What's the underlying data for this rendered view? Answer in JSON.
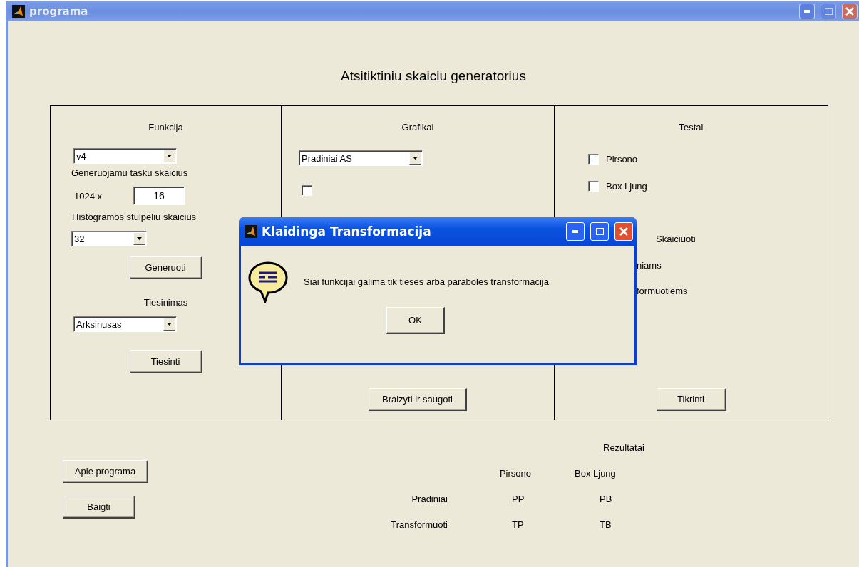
{
  "window": {
    "title": "programa"
  },
  "heading": "Atsitiktiniu skaiciu generatorius",
  "funkcija": {
    "title": "Funkcija",
    "function": "v4",
    "points_label": "Generuojamu tasku skaicius",
    "multiplier": "1024 x",
    "points_value": "16",
    "bins_label": "Histogramos stulpeliu skaicius",
    "bins": "32",
    "generate_button": "Generuoti",
    "transform_title": "Tiesinimas",
    "transform": "Arksinusas",
    "transform_button": "Tiesinti"
  },
  "grafikai": {
    "title": "Grafikai",
    "plot": "Pradiniai AS",
    "checkbox": {
      "checked": false
    },
    "button": "Braizyti ir saugoti"
  },
  "testai": {
    "title": "Testai",
    "tests": [
      {
        "label": "Pirsono",
        "checked": false
      },
      {
        "label": "Box Ljung",
        "checked": false
      }
    ],
    "compute_label": "Skaiciuoti",
    "compute_options": [
      "niams",
      "formuotiems"
    ],
    "button": "Tikrinti"
  },
  "side_buttons": [
    "Apie programa",
    "Baigti"
  ],
  "results": {
    "title": "Rezultatai",
    "columns": [
      "Pirsono",
      "Box Ljung"
    ],
    "rows": [
      {
        "label": "Pradiniai",
        "values": [
          "PP",
          "PB"
        ]
      },
      {
        "label": "Transformuoti",
        "values": [
          "TP",
          "TB"
        ]
      }
    ]
  },
  "dialog": {
    "title": "Klaidinga Transformacija",
    "message": "Siai funkcijai galima tik tieses arba paraboles transformacija",
    "button": "OK"
  }
}
